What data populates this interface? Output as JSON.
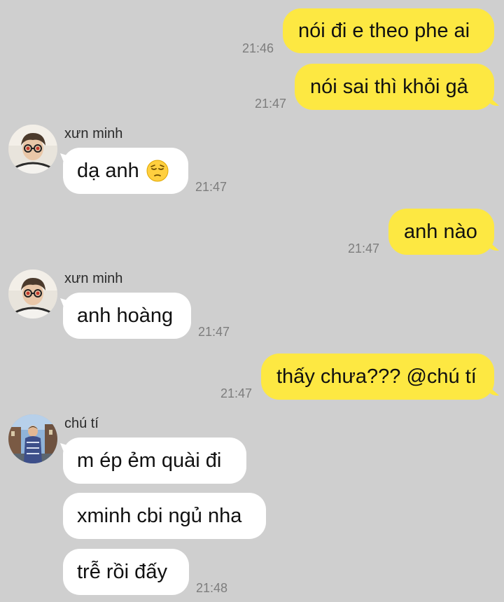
{
  "colors": {
    "background": "#cfcfcf",
    "outgoing_bubble": "#fde842",
    "incoming_bubble": "#ffffff",
    "timestamp": "#7d7d7d"
  },
  "messages": [
    {
      "direction": "outgoing",
      "text": "nói đi e theo phe ai",
      "time": "21:46"
    },
    {
      "direction": "outgoing",
      "text": "nói sai thì khỏi gả",
      "time": "21:47"
    },
    {
      "direction": "incoming",
      "sender": "xưn minh",
      "avatar": "avatar-photo-boy-glasses",
      "text": "dạ anh",
      "emoji": "pensive-face-icon",
      "time": "21:47"
    },
    {
      "direction": "outgoing",
      "text": "anh nào",
      "time": "21:47"
    },
    {
      "direction": "incoming",
      "sender": "xưn minh",
      "avatar": "avatar-photo-boy-glasses",
      "text": "anh hoàng",
      "time": "21:47"
    },
    {
      "direction": "outgoing",
      "text": "thấy chưa??? @chú tí",
      "time": "21:47"
    },
    {
      "direction": "incoming",
      "sender": "chú tí",
      "avatar": "avatar-photo-boy-street",
      "text": "m ép ẻm quài đi"
    },
    {
      "direction": "incoming",
      "text": "xminh cbi ngủ nha"
    },
    {
      "direction": "incoming",
      "text": "trễ rồi đấy",
      "time": "21:48"
    }
  ]
}
